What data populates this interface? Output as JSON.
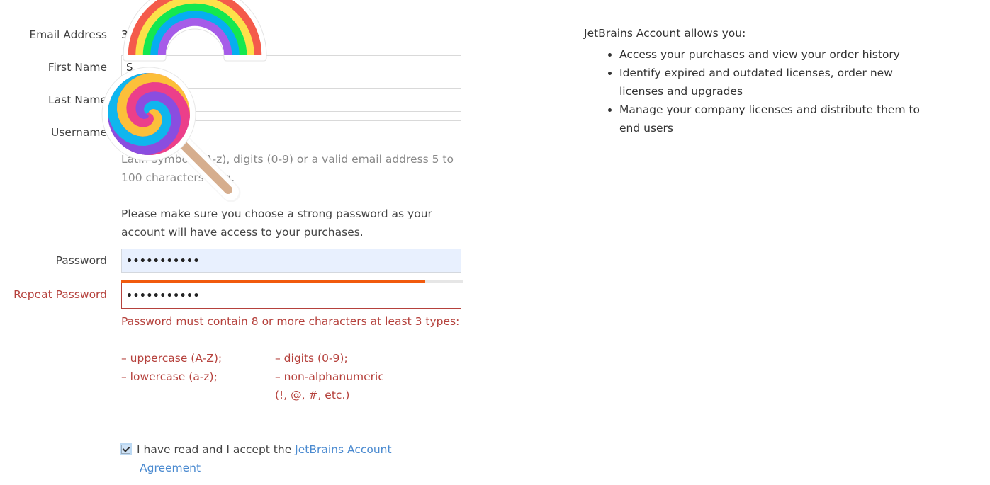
{
  "form": {
    "email": {
      "label": "Email Address",
      "value_visible_fragment": "3"
    },
    "first_name": {
      "label": "First Name",
      "value_visible_fragment": "S"
    },
    "last_name": {
      "label": "Last Name",
      "value": ""
    },
    "username": {
      "label": "Username",
      "value": "",
      "hint": "Latin symbols (A-z), digits (0-9) or a valid email address 5 to 100 characters long."
    },
    "password_note": "Please make sure you choose a strong password as your account will have access to your purchases.",
    "password": {
      "label": "Password",
      "value_masked": "•••••••••••"
    },
    "password_strength": {
      "fraction": 0.89,
      "color": "#f15a0d"
    },
    "repeat_password": {
      "label": "Repeat Password",
      "value_masked": "•••••••••••",
      "state": "error"
    },
    "error": {
      "message": "Password must contain 8 or more characters at least 3 types:",
      "rules": [
        "– uppercase (A-Z);",
        "– digits (0-9);",
        "– lowercase (a-z);",
        "– non-alphanumeric",
        "(!, @, #, etc.)"
      ],
      "color": "#b5413c"
    },
    "agreement": {
      "checked": true,
      "text": "I have read and I accept the",
      "link_line1": "JetBrains Account",
      "link_line2": "Agreement"
    }
  },
  "sidebar": {
    "title": "JetBrains Account allows you:",
    "items": [
      "Access your purchases and view your order history",
      "Identify expired and outdated licenses, order new licenses and upgrades",
      "Manage your company licenses and distribute them to end users"
    ]
  },
  "stickers": [
    {
      "name": "rainbow",
      "colors": [
        "#f45b4b",
        "#fde14a",
        "#14e84f",
        "#06aef0",
        "#a65ce8"
      ]
    },
    {
      "name": "lollipop",
      "colors": [
        "#ec3f8a",
        "#8a4de0",
        "#0fb6ee",
        "#fcbf3a"
      ],
      "stick_color": "#d6ae8e"
    }
  ]
}
